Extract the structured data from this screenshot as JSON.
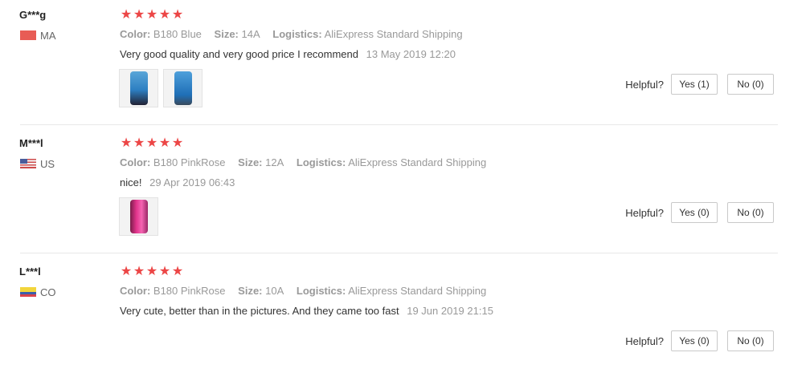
{
  "labels": {
    "color": "Color:",
    "size": "Size:",
    "logistics": "Logistics:",
    "helpful": "Helpful?"
  },
  "reviews": [
    {
      "user": "G***g",
      "country_code": "MA",
      "flag": "morocco-flag-icon",
      "rating": 5,
      "color": "B180 Blue",
      "size": "14A",
      "logistics": "AliExpress Standard Shipping",
      "text": "Very good quality and very good price I recommend",
      "date": "13 May 2019 12:20",
      "photos": 2,
      "yes_label": "Yes (1)",
      "no_label": "No (0)"
    },
    {
      "user": "M***l",
      "country_code": "US",
      "flag": "united-states-flag-icon",
      "rating": 5,
      "color": "B180 PinkRose",
      "size": "12A",
      "logistics": "AliExpress Standard Shipping",
      "text": "nice!",
      "date": "29 Apr 2019 06:43",
      "photos": 1,
      "yes_label": "Yes (0)",
      "no_label": "No (0)"
    },
    {
      "user": "L***l",
      "country_code": "CO",
      "flag": "colombia-flag-icon",
      "rating": 5,
      "color": "B180 PinkRose",
      "size": "10A",
      "logistics": "AliExpress Standard Shipping",
      "text": "Very cute, better than in the pictures. And they came too fast",
      "date": "19 Jun 2019 21:15",
      "photos": 0,
      "yes_label": "Yes (0)",
      "no_label": "No (0)"
    }
  ],
  "colors": {
    "star": "#ec4646",
    "muted_text": "#999999",
    "body_text": "#333333"
  }
}
